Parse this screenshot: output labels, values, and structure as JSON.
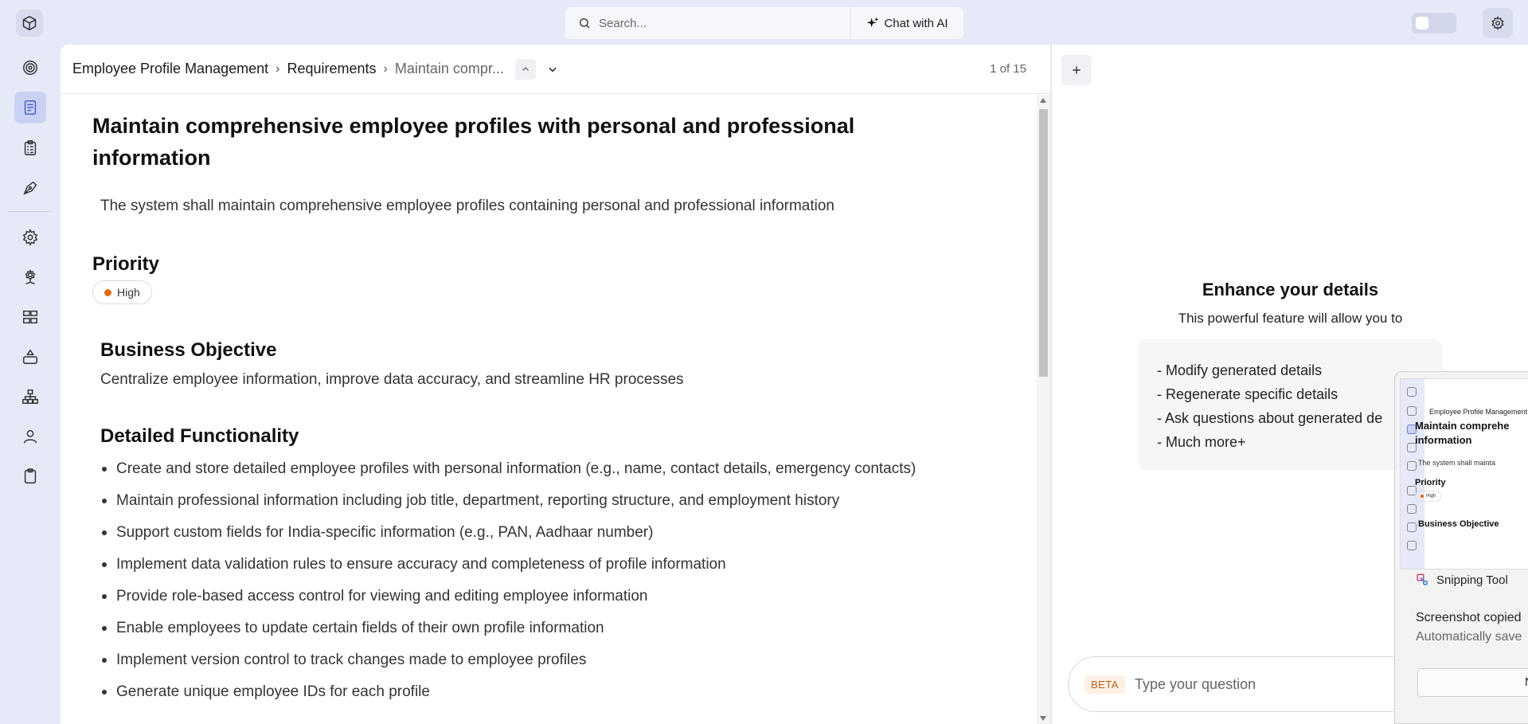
{
  "search": {
    "placeholder": "Search..."
  },
  "chat_ai_label": "Chat with AI",
  "breadcrumb": {
    "project": "Employee Profile Management",
    "section": "Requirements",
    "current": "Maintain compr..."
  },
  "pager": "1 of 15",
  "requirement": {
    "title": "Maintain comprehensive employee profiles with personal and professional information",
    "description": "The system shall maintain comprehensive employee profiles containing personal and professional information",
    "priority_heading": "Priority",
    "priority_value": "High",
    "objective_heading": "Business Objective",
    "objective": "Centralize employee information, improve data accuracy, and streamline HR processes",
    "functionality_heading": "Detailed Functionality",
    "functionality": [
      "Create and store detailed employee profiles with personal information (e.g., name, contact details, emergency contacts)",
      "Maintain professional information including job title, department, reporting structure, and employment history",
      "Support custom fields for India-specific information (e.g., PAN, Aadhaar number)",
      "Implement data validation rules to ensure accuracy and completeness of profile information",
      "Provide role-based access control for viewing and editing employee information",
      "Enable employees to update certain fields of their own profile information",
      "Implement version control to track changes made to employee profiles",
      "Generate unique employee IDs for each profile"
    ]
  },
  "enhance": {
    "title": "Enhance your details",
    "subtitle": "This powerful feature will allow you to",
    "items": [
      "- Modify generated details",
      "- Regenerate specific details",
      "- Ask questions about generated de",
      "- Much more+"
    ]
  },
  "chat": {
    "beta": "BETA",
    "placeholder": "Type your question"
  },
  "snipping": {
    "app_name": "Snipping Tool",
    "message": "Screenshot copied",
    "submessage": "Automatically save",
    "button_label": "N",
    "thumb_crumb": "Employee Profile Management",
    "thumb_title_1": "Maintain comprehe",
    "thumb_title_2": "information",
    "thumb_desc": "The system shall mainta",
    "thumb_priority": "Priority",
    "thumb_badge": "High",
    "thumb_objective": "Business Objective"
  },
  "colors": {
    "accent": "#6f82d8",
    "priority_high": "#e06c1a",
    "beta": "#c0601a",
    "sidebar_bg": "#e6e9f7"
  },
  "icons": {
    "sidebar": [
      "target-icon",
      "document-icon",
      "clipboard-list-icon",
      "pen-tool-icon",
      "gear-icon",
      "gear-network-icon",
      "grid-icon",
      "shapes-icon",
      "hierarchy-icon",
      "user-icon",
      "clipboard-icon"
    ]
  }
}
